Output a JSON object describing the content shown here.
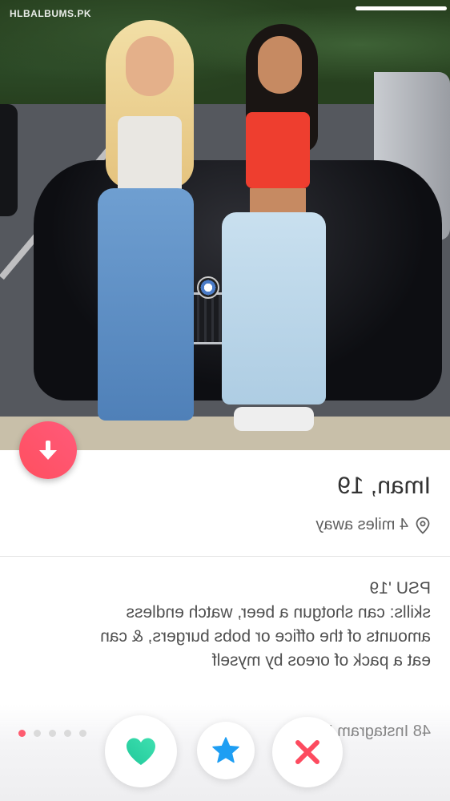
{
  "watermark": "HLBALBUMS.PK",
  "profile": {
    "name": "Iman, 19",
    "distance": "4 miles away"
  },
  "bio": {
    "lines": [
      "PSU '19",
      "skills: can shotgun a beer, watch endless",
      "amounts of the office or bobs burgers, & can",
      "eat a pack of oreos by myself"
    ]
  },
  "footer": {
    "instagram_text": "48 Instagram Photos"
  },
  "photo_dots": {
    "count": 5,
    "active_index": 0
  },
  "icons": {
    "fab": "down-arrow-icon",
    "location": "location-pin-icon",
    "nope": "x-icon",
    "super_like": "star-icon",
    "like": "heart-icon"
  },
  "colors": {
    "brand_pink": "#fe5c70",
    "nope_red": "#fd4b5f",
    "star_blue": "#1e9ef3",
    "like_green": "#2fd7a5"
  }
}
